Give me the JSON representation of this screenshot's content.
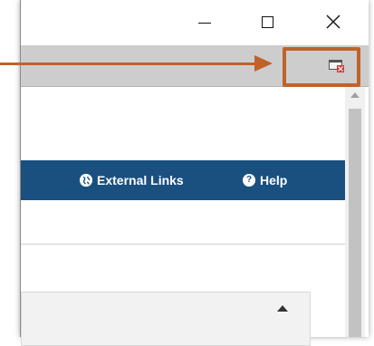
{
  "window": {
    "controls": [
      "minimize",
      "maximize",
      "close"
    ]
  },
  "navbar": {
    "external_links_label": "External Links",
    "help_label": "Help",
    "background_color": "#1a5080"
  },
  "callout": {
    "highlight_color": "#c0622b"
  }
}
